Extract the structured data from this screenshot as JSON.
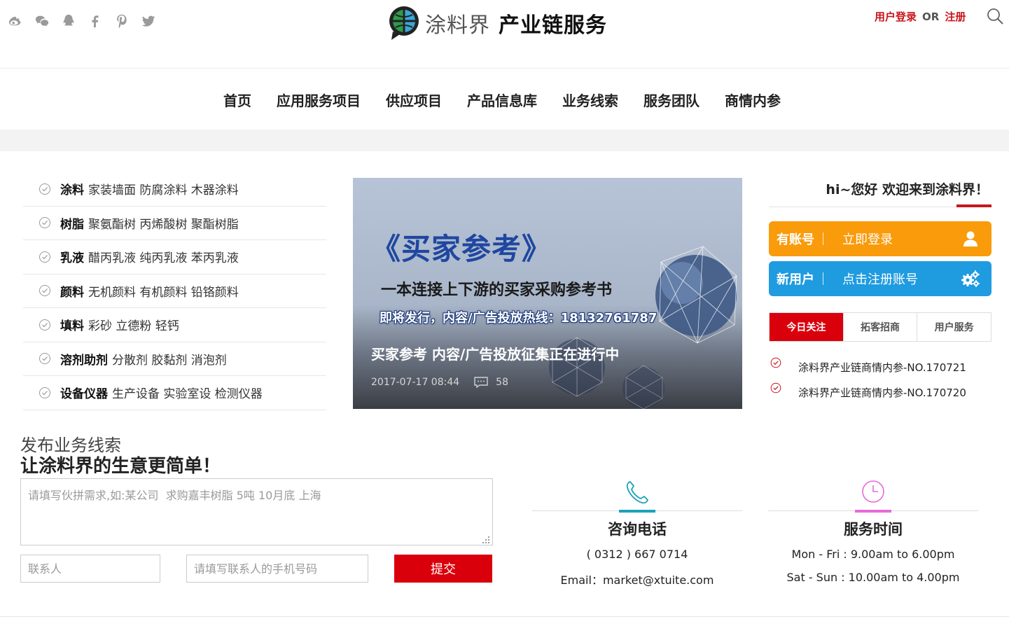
{
  "header": {
    "social": [
      "weibo-icon",
      "wechat-icon",
      "qq-icon",
      "facebook-icon",
      "pinterest-icon",
      "twitter-icon"
    ],
    "logo_text_light": "涂料界",
    "logo_text_bold": "产业链服务",
    "login_label": "用户登录",
    "or_label": "OR",
    "register_label": "注册"
  },
  "nav": {
    "items": [
      "首页",
      "应用服务项目",
      "供应项目",
      "产品信息库",
      "业务线索",
      "服务团队",
      "商情内参"
    ]
  },
  "categories": [
    {
      "name": "涂料",
      "sub": "家装墙面 防腐涂料 木器涂料"
    },
    {
      "name": "树脂",
      "sub": "聚氨酯树 丙烯酸树 聚酯树脂"
    },
    {
      "name": "乳液",
      "sub": "醋丙乳液 纯丙乳液 苯丙乳液"
    },
    {
      "name": "颜料",
      "sub": "无机颜料 有机颜料 铅铬颜料"
    },
    {
      "name": "填料",
      "sub": "彩砂 立德粉 轻钙"
    },
    {
      "name": "溶剂助剂",
      "sub": "分散剂 胶黏剂 消泡剂"
    },
    {
      "name": "设备仪器",
      "sub": "生产设备 实验室设 检测仪器"
    }
  ],
  "banner": {
    "title": "《买家参考》",
    "subtitle": "一本连接上下游的买家采购参考书",
    "hotline": "即将发行，内容/广告投放热线：18132761787",
    "caption": "买家参考 内容/广告投放征集正在进行中",
    "date": "2017-07-17 08:44",
    "comments": "58"
  },
  "account": {
    "welcome": "hi~您好 欢迎来到涂料界！",
    "login_label": "有账号",
    "login_action": "立即登录",
    "register_label": "新用户",
    "register_action": "点击注册账号"
  },
  "tabs": [
    "今日关注",
    "拓客招商",
    "用户服务"
  ],
  "news": [
    "涂料界产业链商情内参-NO.170721",
    "涂料界产业链商情内参-NO.170720"
  ],
  "lead": {
    "title_light": "发布业务线索",
    "title_bold": "让涂料界的生意更简单！",
    "textarea_placeholder": "请填写伙拼需求,如:某公司  求购嘉丰树脂 5吨 10月底 上海",
    "contact_placeholder": "联系人",
    "phone_placeholder": "请填写联系人的手机号码",
    "submit_label": "提交"
  },
  "contact": {
    "title": "咨询电话",
    "phone": "( 0312 ) 667 0714",
    "email": "Email：market@xtuite.com",
    "accent": "#1aa3b8"
  },
  "hours": {
    "title": "服务时间",
    "weekday": "Mon - Fri : 9.00am to 6.00pm",
    "weekend": "Sat - Sun : 10.00am to 4.00pm",
    "accent": "#e86ad8"
  },
  "colors": {
    "brand_red": "#d9000c",
    "login_orange": "#f99b0b",
    "register_blue": "#1f9be0"
  }
}
